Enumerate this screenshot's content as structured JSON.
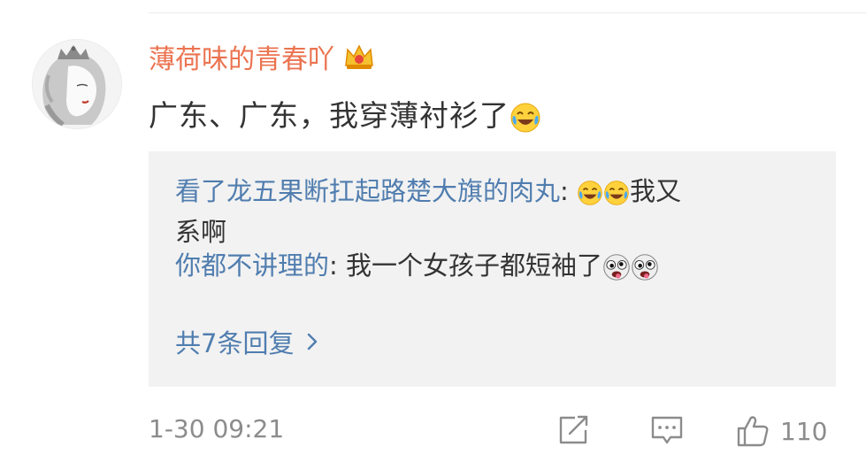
{
  "comment": {
    "username": "薄荷味的青春吖",
    "text": "广东、广东，我穿薄衬衫了",
    "time": "1-30 09:21",
    "like_count": "110"
  },
  "replies": [
    {
      "name": "看了龙五果断扛起路楚大旗的肉丸",
      "sep": ": ",
      "text_a": "我又",
      "text_b": "系啊"
    },
    {
      "name": "你都不讲理的",
      "sep": ": ",
      "text": "我一个女孩子都短袖了"
    }
  ],
  "more_replies": "共7条回复",
  "icons": {
    "crown": "crown-vip-icon",
    "laugh_cry": "laugh-cry-emoji",
    "silly": "silly-face-emoji",
    "share": "share-icon",
    "reply": "comment-icon",
    "like": "thumbs-up-icon",
    "chevron": "chevron-right-icon"
  },
  "colors": {
    "username": "#eb7350",
    "reply_name": "#507daf",
    "meta": "#8c8c8c",
    "reply_bg": "#f2f2f2"
  }
}
